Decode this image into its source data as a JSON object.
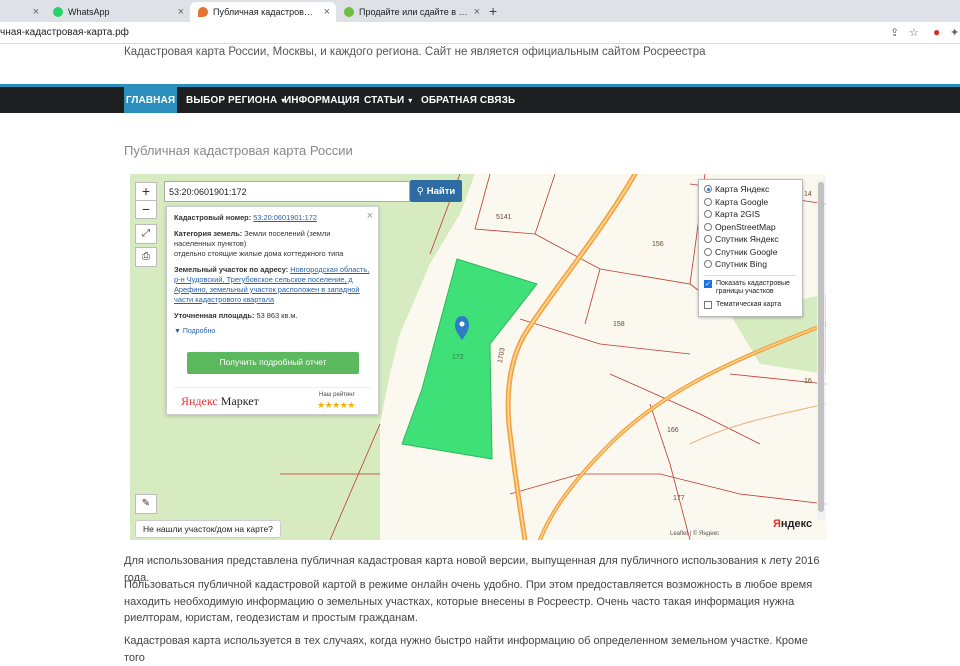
{
  "browser": {
    "tabs": [
      {
        "label": "WhatsApp",
        "icon": "whatsapp-icon",
        "color": "#25d366"
      },
      {
        "label": "Публичная кадастровая карта Р",
        "icon": "map-pin-favicon",
        "color": "#e57332"
      },
      {
        "label": "Продайте или сдайте в аренду",
        "icon": "avito-icon",
        "color": "#6cbf3f"
      }
    ],
    "new_tab": "+",
    "url": "чная-кадастровая-карта.рф",
    "close": "×"
  },
  "site": {
    "tagline": "Кадастровая карта России, Москвы, и каждого региона. Сайт не является официальным сайтом Росреестра",
    "nav": [
      {
        "label": "ГЛАВНАЯ",
        "active": true
      },
      {
        "label": "ВЫБОР РЕГИОНА",
        "dropdown": true
      },
      {
        "label": "ИНФОРМАЦИЯ"
      },
      {
        "label": "СТАТЬИ",
        "dropdown": true
      },
      {
        "label": "ОБРАТНАЯ СВЯЗЬ"
      }
    ],
    "chevron": "▾",
    "heading": "Публичная кадастровая карта России"
  },
  "map": {
    "zoom_in": "+",
    "zoom_out": "−",
    "search_value": "53:20:0601901:172",
    "search_button": "Найти",
    "info": {
      "cadastral_label": "Кадастровый номер:",
      "cadastral_value": "53:20:0601901:172",
      "category_label": "Категория земель:",
      "category_value": "Земли поселений (земли населенных пунктов)",
      "category_extra": "отдельно стоящие жилые дома коттеджного типа",
      "address_label": "Земельный участок по адресу:",
      "address_value": "Новгородская область, р-н Чудовский, Трегубовское сельское поселение, д Арефино, земельный участок расположен в западной части кадастрового квартала",
      "area_label": "Уточненная площадь:",
      "area_value": "53 863 кв.м.",
      "more": "Подробно",
      "report_button": "Получить подробный отчет",
      "market_logo_y": "Яндекс",
      "market_logo_m": "Маркет",
      "rating_caption": "Наш рейтинг",
      "stars": "★★★★★"
    },
    "layers": {
      "options": [
        {
          "label": "Карта Яндекс",
          "selected": true
        },
        {
          "label": "Карта Google",
          "selected": false
        },
        {
          "label": "Карта 2GIS",
          "selected": false
        },
        {
          "label": "OpenStreetMap",
          "selected": false
        },
        {
          "label": "Спутник Яндекс",
          "selected": false
        },
        {
          "label": "Спутник Google",
          "selected": false
        },
        {
          "label": "Спутник Bing",
          "selected": false
        }
      ],
      "show_boundaries": "Показать кадастровые границы участков",
      "thematic": "Тематическая карта"
    },
    "parcel_labels": [
      "5141",
      "156",
      "158",
      "166",
      "177",
      "172",
      "1703",
      "14",
      "16"
    ],
    "not_found": "Не нашли участок/дом на карте?",
    "yandex_logo_y": "Я",
    "yandex_logo_rest": "ндекс",
    "attribution": "Leaflet | © Яндекс",
    "colors": {
      "highlight": "#3ee077",
      "road": "#f2a03d",
      "boundary": "#c0392b",
      "forest": "#d6ecc0"
    }
  },
  "body": {
    "p1": "Для использования представлена публичная кадастровая карта новой версии, выпущенная для публичного использования к лету 2016 года.",
    "p2": "Пользоваться публичной кадастровой картой в режиме онлайн очень удобно. При этом предоставляется возможность в любое время находить необходимую информацию о земельных участках, которые внесены в Росреестр. Очень часто такая информация нужна риелторам, юристам, геодезистам и простым гражданам.",
    "p3": "Кадастровая карта используется в тех случаях, когда нужно быстро найти информацию об определенном земельном участке. Кроме того"
  }
}
